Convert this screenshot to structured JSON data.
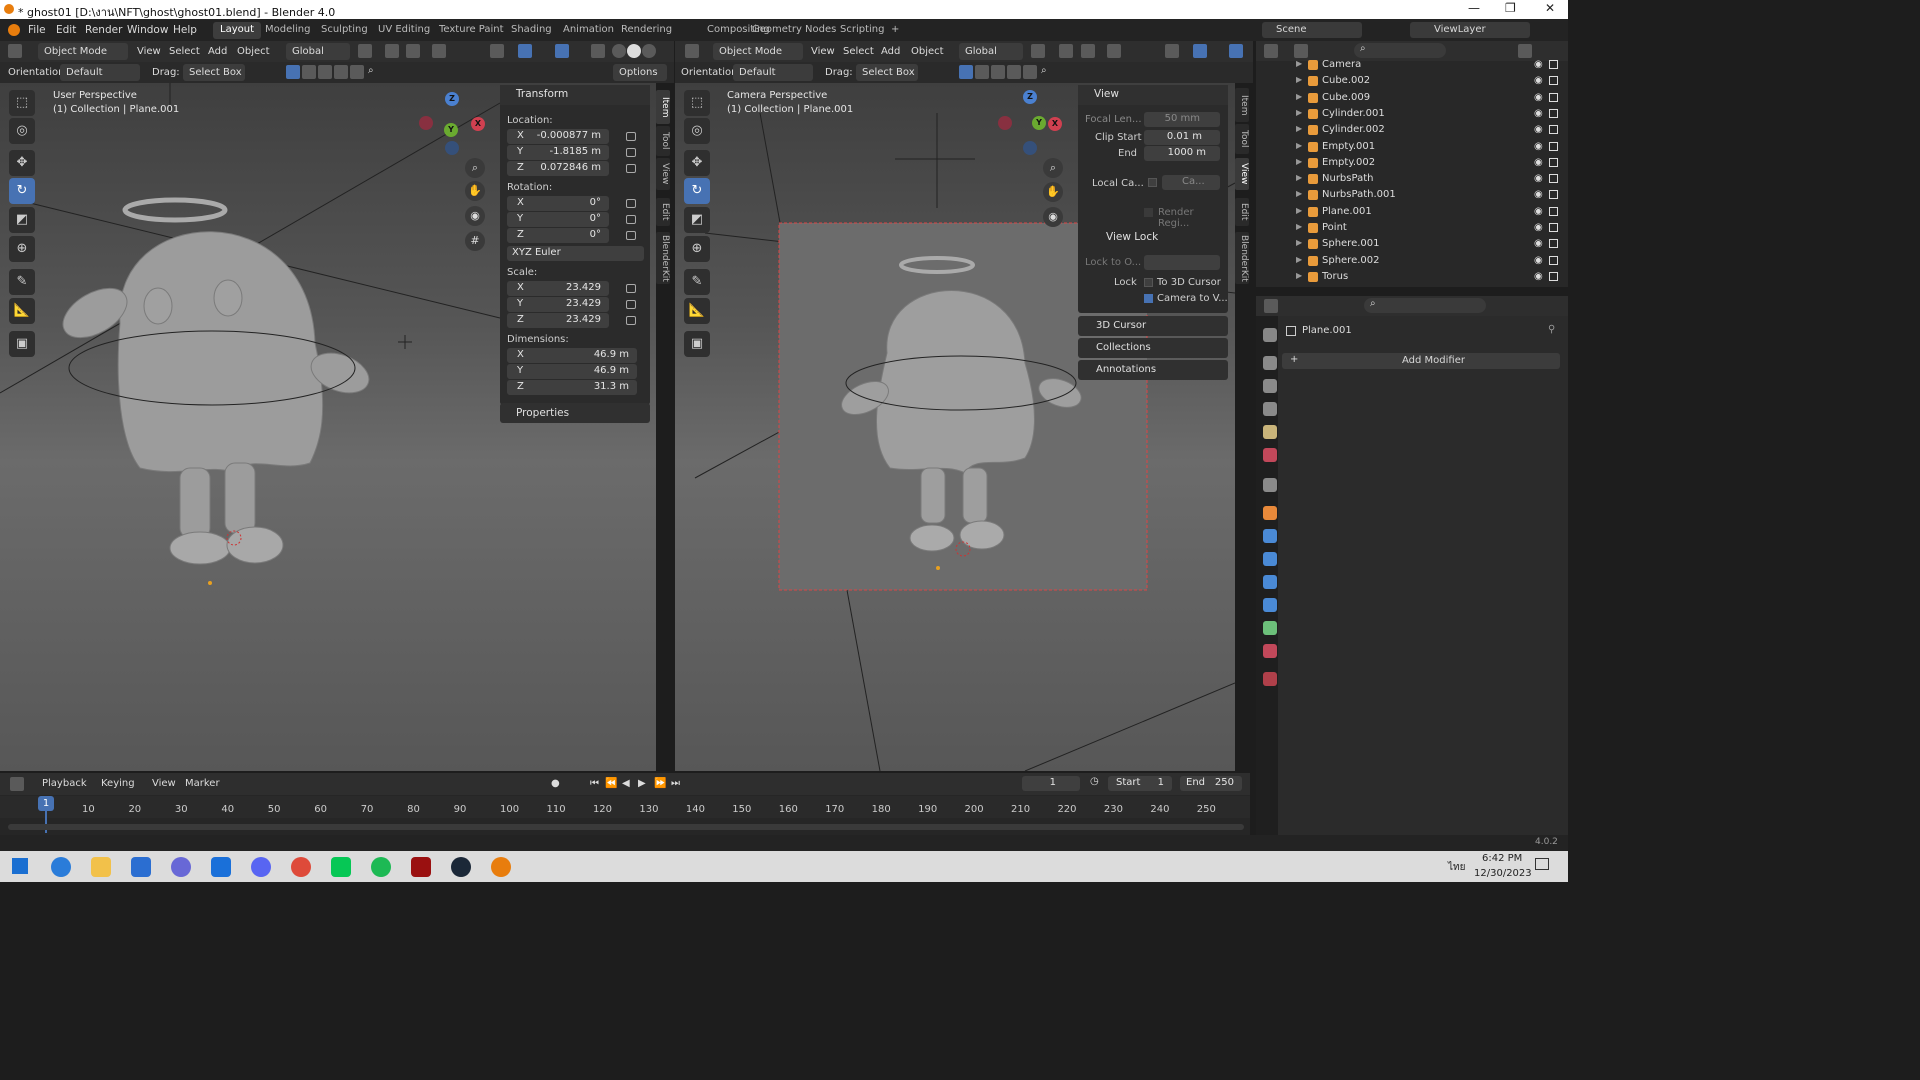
{
  "window": {
    "title": "* ghost01 [D:\\งาน\\NFT\\ghost\\ghost01.blend] - Blender 4.0",
    "min": "—",
    "max": "❐",
    "close": "✕"
  },
  "menu": [
    "File",
    "Edit",
    "Render",
    "Window",
    "Help"
  ],
  "workspaces": [
    "Layout",
    "Modeling",
    "Sculpting",
    "UV Editing",
    "Texture Paint",
    "Shading",
    "Animation",
    "Rendering",
    "Compositing",
    "Geometry Nodes",
    "Scripting",
    "+"
  ],
  "scene": {
    "label": "Scene",
    "viewlayer": "ViewLayer"
  },
  "vp1": {
    "mode": "Object Mode",
    "menus": [
      "View",
      "Select",
      "Add",
      "Object"
    ],
    "transform": "Global",
    "orientation_label": "Orientation:",
    "orientation": "Default",
    "drag_label": "Drag:",
    "drag": "Select Box",
    "options": "Options",
    "label1": "User Perspective",
    "label2": "(1) Collection | Plane.001"
  },
  "npanel1": {
    "header": "Transform",
    "location": "Location:",
    "loc": [
      {
        "a": "X",
        "v": "-0.000877 m"
      },
      {
        "a": "Y",
        "v": "-1.8185 m"
      },
      {
        "a": "Z",
        "v": "0.072846 m"
      }
    ],
    "rotation": "Rotation:",
    "rot": [
      {
        "a": "X",
        "v": "0°"
      },
      {
        "a": "Y",
        "v": "0°"
      },
      {
        "a": "Z",
        "v": "0°"
      }
    ],
    "euler": "XYZ Euler",
    "scale": "Scale:",
    "scl": [
      {
        "a": "X",
        "v": "23.429"
      },
      {
        "a": "Y",
        "v": "23.429"
      },
      {
        "a": "Z",
        "v": "23.429"
      }
    ],
    "dimensions": "Dimensions:",
    "dim": [
      {
        "a": "X",
        "v": "46.9 m"
      },
      {
        "a": "Y",
        "v": "46.9 m"
      },
      {
        "a": "Z",
        "v": "31.3 m"
      }
    ],
    "properties": "Properties",
    "tabs": [
      "Item",
      "Tool",
      "View",
      "Edit",
      "BlenderKit"
    ]
  },
  "vp2": {
    "mode": "Object Mode",
    "menus": [
      "View",
      "Select",
      "Add",
      "Object"
    ],
    "transform": "Global",
    "orientation_label": "Orientation:",
    "orientation": "Default",
    "drag_label": "Drag:",
    "drag": "Select Box",
    "label1": "Camera Perspective",
    "label2": "(1) Collection | Plane.001"
  },
  "npanel2": {
    "view": "View",
    "focal_label": "Focal Len...",
    "focal": "50 mm",
    "clip_start_label": "Clip Start",
    "clip_start": "0.01 m",
    "end_label": "End",
    "end": "1000 m",
    "local_cam": "Local Ca...",
    "local_cam_val": "Ca...",
    "render_region": "Render Regi...",
    "view_lock": "View Lock",
    "lock_to": "Lock to O...",
    "lock": "Lock",
    "to_cursor": "To 3D Cursor",
    "cam_to_view": "Camera to V...",
    "cursor3d": "3D Cursor",
    "collections": "Collections",
    "annotations": "Annotations",
    "tabs": [
      "Item",
      "Tool",
      "View",
      "Edit",
      "BlenderKit"
    ]
  },
  "outliner": [
    {
      "n": "Camera"
    },
    {
      "n": "Cube.002"
    },
    {
      "n": "Cube.009"
    },
    {
      "n": "Cylinder.001"
    },
    {
      "n": "Cylinder.002"
    },
    {
      "n": "Empty.001"
    },
    {
      "n": "Empty.002"
    },
    {
      "n": "NurbsPath"
    },
    {
      "n": "NurbsPath.001"
    },
    {
      "n": "Plane.001"
    },
    {
      "n": "Point"
    },
    {
      "n": "Sphere.001"
    },
    {
      "n": "Sphere.002"
    },
    {
      "n": "Torus"
    }
  ],
  "props": {
    "object": "Plane.001",
    "add_modifier": "Add Modifier"
  },
  "timeline": {
    "menus": [
      "Playback",
      "Keying",
      "View",
      "Marker"
    ],
    "frame": "1",
    "start_label": "Start",
    "start": "1",
    "end_label": "End",
    "end": "250",
    "current": "1",
    "ticks": [
      "10",
      "20",
      "30",
      "40",
      "50",
      "60",
      "70",
      "80",
      "90",
      "100",
      "110",
      "120",
      "130",
      "140",
      "150",
      "160",
      "170",
      "180",
      "190",
      "200",
      "210",
      "220",
      "230",
      "240",
      "250"
    ]
  },
  "status": {
    "version": "4.0.2"
  },
  "taskbar": {
    "time": "6:42 PM",
    "date": "12/30/2023",
    "lang": "ไทย"
  }
}
